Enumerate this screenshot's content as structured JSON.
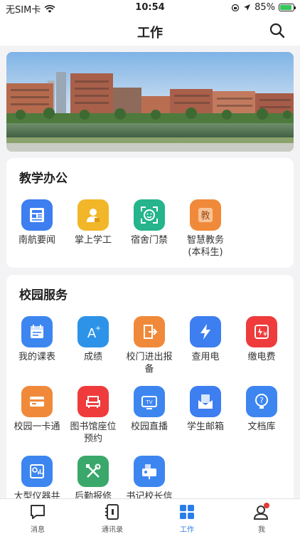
{
  "status": {
    "carrier": "无SIM卡",
    "time": "10:54",
    "battery": "85%"
  },
  "header": {
    "title": "工作"
  },
  "sections": [
    {
      "title": "教学办公",
      "items": [
        {
          "label": "南航要闻",
          "icon": "news-icon",
          "color": "#3d7ef0"
        },
        {
          "label": "掌上学工",
          "icon": "student-icon",
          "color": "#f2b728"
        },
        {
          "label": "宿舍门禁",
          "icon": "face-scan-icon",
          "color": "#25b48c"
        },
        {
          "label": "智慧教务\n(本科生)",
          "icon": "teaching-icon",
          "color": "#f08a3a"
        }
      ]
    },
    {
      "title": "校园服务",
      "items": [
        {
          "label": "我的课表",
          "icon": "schedule-icon",
          "color": "#3d86f0"
        },
        {
          "label": "成绩",
          "icon": "grade-icon",
          "color": "#2d93e8"
        },
        {
          "label": "校门进出报\n备",
          "icon": "gate-exit-icon",
          "color": "#f08a3a"
        },
        {
          "label": "查用电",
          "icon": "lightning-icon",
          "color": "#3d7ef0"
        },
        {
          "label": "缴电费",
          "icon": "electric-bill-icon",
          "color": "#ef3b3b"
        },
        {
          "label": "校园一卡通",
          "icon": "campus-card-icon",
          "color": "#f08a3a"
        },
        {
          "label": "图书馆座位\n预约",
          "icon": "library-seat-icon",
          "color": "#ef3b3b"
        },
        {
          "label": "校园直播",
          "icon": "tv-icon",
          "color": "#3d86f0"
        },
        {
          "label": "学生邮箱",
          "icon": "mail-icon",
          "color": "#3d7ef0"
        },
        {
          "label": "文档库",
          "icon": "question-doc-icon",
          "color": "#3d86f0"
        },
        {
          "label": "大型仪器共",
          "icon": "instrument-icon",
          "color": "#3d86f0"
        },
        {
          "label": "后勤报修",
          "icon": "repair-tools-icon",
          "color": "#3aa86b"
        },
        {
          "label": "书记校长信",
          "icon": "mailbox-icon",
          "color": "#3d86f0"
        }
      ]
    }
  ],
  "tabs": [
    {
      "label": "消息",
      "icon": "message-icon"
    },
    {
      "label": "通讯录",
      "icon": "contacts-icon"
    },
    {
      "label": "工作",
      "icon": "grid-icon",
      "active": true
    },
    {
      "label": "我",
      "icon": "profile-icon"
    }
  ],
  "colors": {
    "accent": "#2b7de9",
    "badge": "#e53935"
  }
}
